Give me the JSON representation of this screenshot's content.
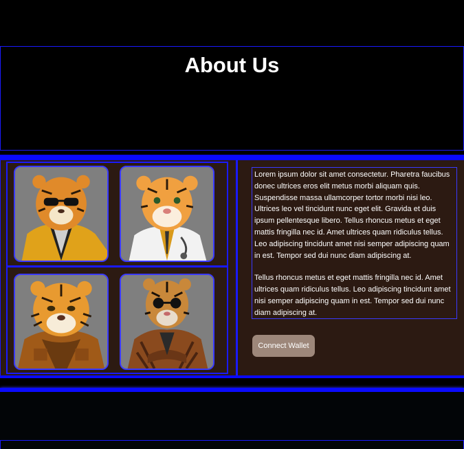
{
  "about": {
    "title": "About Us"
  },
  "gallery": {
    "images": [
      {
        "name": "tiger-sunglasses-yellow-jacket"
      },
      {
        "name": "tiger-doctor-coat"
      },
      {
        "name": "tiger-leather-jacket"
      },
      {
        "name": "tiger-suit-sunglasses"
      }
    ]
  },
  "content": {
    "paragraph1": "Lorem ipsum dolor sit amet consectetur. Pharetra faucibus donec ultrices eros elit metus morbi aliquam quis. Suspendisse massa ullamcorper tortor morbi nisi leo. Ultrices leo vel tincidunt nunc eget elit. Gravida et duis ipsum pellentesque libero. Tellus rhoncus metus et eget mattis fringilla nec id. Amet ultrices quam ridiculus tellus. Leo adipiscing tincidunt amet nisi semper adipiscing quam in est. Tempor sed dui nunc diam adipiscing at.",
    "paragraph2": "Tellus rhoncus metus et eget mattis fringilla nec id. Amet ultrices quam ridiculus tellus. Leo adipiscing tincidunt amet nisi semper adipiscing quam in est. Tempor sed dui nunc diam adipiscing at.",
    "button_label": "Connect Wallet"
  },
  "colors": {
    "accent_blue": "#0a0aff",
    "panel_brown": "#2c1a12",
    "button": "#9d877a"
  }
}
